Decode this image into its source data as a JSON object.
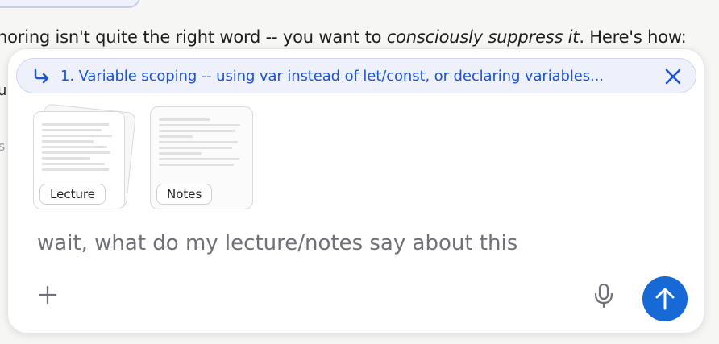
{
  "background": {
    "text_main": "noring isn't quite the right word -- you want to ",
    "text_emph": "consciously suppress it",
    "text_end": ". Here's how:",
    "stub_left": "u",
    "stub_left2": "s"
  },
  "reply": {
    "icon": "reply-arrow-icon",
    "text": "1. Variable scoping -- using var instead of let/const, or declaring variables...",
    "close_icon": "close-icon"
  },
  "attachments": [
    {
      "label": "Lecture",
      "icon": "document-stack-icon"
    },
    {
      "label": "Notes",
      "icon": "document-icon"
    }
  ],
  "composer": {
    "message": "wait, what do my lecture/notes say about this",
    "add_icon": "plus-icon",
    "mic_icon": "microphone-icon",
    "send_icon": "arrow-up-icon"
  },
  "colors": {
    "accent": "#1a53d6",
    "send_button": "#1769d6",
    "reply_bg": "#eef1fb"
  }
}
